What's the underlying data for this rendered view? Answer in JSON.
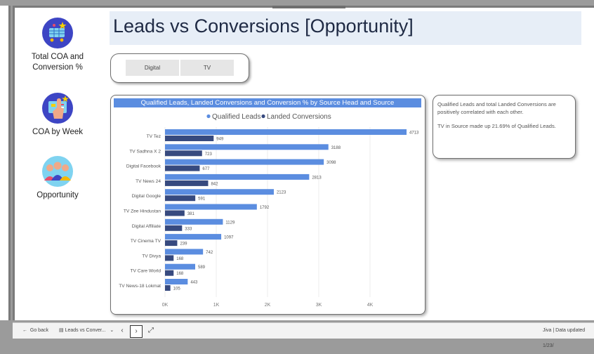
{
  "title": "Leads vs Conversions [Opportunity]",
  "nav": [
    {
      "label_line1": "Total COA and",
      "label_line2": "Conversion %"
    },
    {
      "label_line1": "COA by Week",
      "label_line2": ""
    },
    {
      "label_line1": "Opportunity",
      "label_line2": ""
    }
  ],
  "slicer": {
    "options": [
      "Digital",
      "TV"
    ]
  },
  "notes": {
    "line1": "Qualified Leads and total Landed Conversions are positively correlated with each other.",
    "line2": "TV in Source  made up 21.69% of Qualified Leads."
  },
  "statusbar": {
    "go_back": "Go back",
    "page_tab": "Leads vs Conver...",
    "right_text": "Jiva  |  Data updated 1/23/"
  },
  "colors": {
    "qualified": "#5b8de0",
    "landed": "#374a7f",
    "title_band": "#e7eef7"
  },
  "chart_data": {
    "type": "bar",
    "orientation": "horizontal",
    "title": "Qualified Leads, Landed Conversions and Conversion % by Source Head and Source",
    "categories": [
      "TV Tez",
      "TV Sadhna X 2",
      "Digital Facebook",
      "TV News 24",
      "Digital Google",
      "TV Zee Hindustan",
      "Digital Affiliate",
      "TV Cinema TV",
      "TV Divya",
      "TV Care World",
      "TV News-18 Lokmat"
    ],
    "series": [
      {
        "name": "Qualified Leads",
        "values": [
          4713,
          3188,
          3098,
          2813,
          2123,
          1792,
          1129,
          1097,
          742,
          589,
          443
        ],
        "color": "#5b8de0"
      },
      {
        "name": "Landed Conversions",
        "values": [
          949,
          723,
          677,
          842,
          591,
          381,
          333,
          239,
          168,
          168,
          105
        ],
        "color": "#374a7f"
      }
    ],
    "xticks": [
      "0K",
      "1K",
      "2K",
      "3K",
      "4K"
    ],
    "xlim": [
      0,
      5000
    ],
    "legend": "top-center",
    "grid": true
  }
}
